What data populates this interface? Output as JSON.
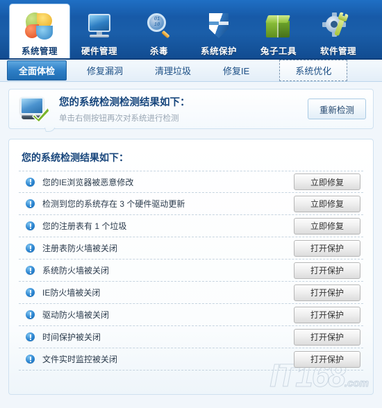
{
  "toolbar": {
    "items": [
      {
        "label": "系统管理",
        "icon": "pie-chart-icon",
        "active": true
      },
      {
        "label": "硬件管理",
        "icon": "monitor-icon",
        "active": false
      },
      {
        "label": "杀毒",
        "icon": "magnifier-icon",
        "active": false
      },
      {
        "label": "系统保护",
        "icon": "shield-icon",
        "active": false
      },
      {
        "label": "兔子工具",
        "icon": "green-box-icon",
        "active": false
      },
      {
        "label": "软件管理",
        "icon": "gear-wrench-icon",
        "active": false
      }
    ]
  },
  "subtabs": {
    "items": [
      {
        "label": "全面体检",
        "state": "selected"
      },
      {
        "label": "修复漏洞",
        "state": "normal"
      },
      {
        "label": "清理垃圾",
        "state": "normal"
      },
      {
        "label": "修复IE",
        "state": "normal"
      },
      {
        "label": "系统优化",
        "state": "focused"
      }
    ]
  },
  "banner": {
    "icon": "monitor-check-icon",
    "title": "您的系统检测检测结果如下：",
    "subtitle": "单击右侧按钮再次对系统进行检测",
    "rescan_label": "重新检测"
  },
  "results": {
    "title": "您的系统检测结果如下：",
    "rows": [
      {
        "icon": "info-exclamation-icon",
        "label": "您的IE浏览器被恶意修改",
        "action": "立即修复"
      },
      {
        "icon": "info-exclamation-icon",
        "label": "检测到您的系统存在 3 个硬件驱动更新",
        "action": "立即修复"
      },
      {
        "icon": "info-exclamation-icon",
        "label": "您的注册表有 1 个垃圾",
        "action": "立即修复"
      },
      {
        "icon": "info-exclamation-icon",
        "label": "注册表防火墙被关闭",
        "action": "打开保护"
      },
      {
        "icon": "info-exclamation-icon",
        "label": "系统防火墙被关闭",
        "action": "打开保护"
      },
      {
        "icon": "info-exclamation-icon",
        "label": "IE防火墙被关闭",
        "action": "打开保护"
      },
      {
        "icon": "info-exclamation-icon",
        "label": "驱动防火墙被关闭",
        "action": "打开保护"
      },
      {
        "icon": "info-exclamation-icon",
        "label": "时间保护被关闭",
        "action": "打开保护"
      },
      {
        "icon": "info-exclamation-icon",
        "label": "文件实时监控被关闭",
        "action": "打开保护"
      }
    ]
  },
  "watermark": {
    "text": "IT168",
    "suffix": ".com"
  },
  "colors": {
    "toolbar_blue": "#175aa8",
    "tab_selected": "#2e7fc6",
    "panel_border": "#cfe1f0",
    "title_text": "#17457b",
    "warn_icon": "#2a84d0",
    "page_bg": "#f1f6fb"
  }
}
